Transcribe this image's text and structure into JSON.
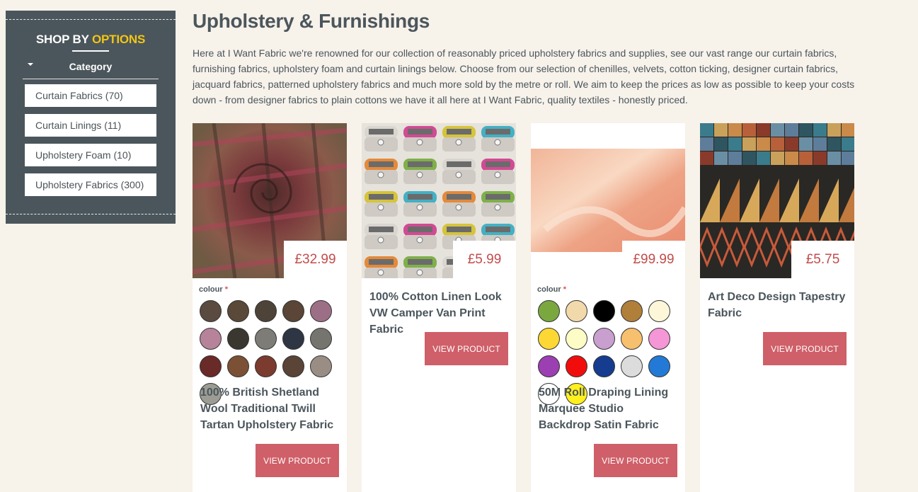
{
  "sidebar": {
    "title_part1": "SHOP BY",
    "title_part2": "OPTIONS",
    "category_label": "Category",
    "items": [
      {
        "label": "Curtain Fabrics (70)"
      },
      {
        "label": "Curtain Linings (11)"
      },
      {
        "label": "Upholstery Foam (10)"
      },
      {
        "label": "Upholstery Fabrics (300)"
      }
    ]
  },
  "main": {
    "title": "Upholstery & Furnishings",
    "intro": "Here at I Want Fabric we're renowned for our collection of reasonably priced upholstery fabrics and supplies, see our vast range our curtain fabrics, furnishing fabrics, upholstery foam and curtain linings below. Choose from our selection of chenilles, velvets, cotton ticking, designer curtain fabrics, jacquard fabrics, patterned upholstery fabrics and much more sold by the metre or roll. We aim to keep the prices as low as possible to keep your costs down - from designer fabrics to plain cottons we have it all here at I Want Fabric, quality textiles - honestly priced."
  },
  "products": [
    {
      "price": "£32.99",
      "colour_label": "colour",
      "required_mark": "*",
      "name": "100% British Shetland Wool Traditional Twill Tartan Upholstery Fabric",
      "button": "VIEW PRODUCT",
      "swatches": [
        "#5b4a3f",
        "#5a4838",
        "#4e4338",
        "#5a4536",
        "#9c6f86",
        "#b7839a",
        "#3a3630",
        "#7d7c76",
        "#2e3644",
        "#75746e",
        "#6a2a28",
        "#7b5035",
        "#7b3b2e",
        "#5a4337",
        "#9a8e84",
        "#9c9c94"
      ]
    },
    {
      "price": "£5.99",
      "name": "100% Cotton Linen Look VW Camper Van Print Fabric",
      "button": "VIEW PRODUCT"
    },
    {
      "price": "£99.99",
      "colour_label": "colour",
      "required_mark": "*",
      "name": "50M Roll Draping Lining Marquee Studio Backdrop Satin Fabric",
      "button": "VIEW PRODUCT",
      "swatches": [
        "#7aa83f",
        "#f2d9ab",
        "#000000",
        "#b07f3a",
        "#fdf6d9",
        "#fdd835",
        "#fdfbc6",
        "#c89fce",
        "#f6c06e",
        "#f596d6",
        "#9c3fb2",
        "#f20d0d",
        "#153c8e",
        "#dcdcdc",
        "#2379d6",
        "#ffffff",
        "#fff01e"
      ]
    },
    {
      "price": "£5.75",
      "name": "Art Deco Design Tapestry Fabric",
      "button": "VIEW PRODUCT"
    }
  ]
}
